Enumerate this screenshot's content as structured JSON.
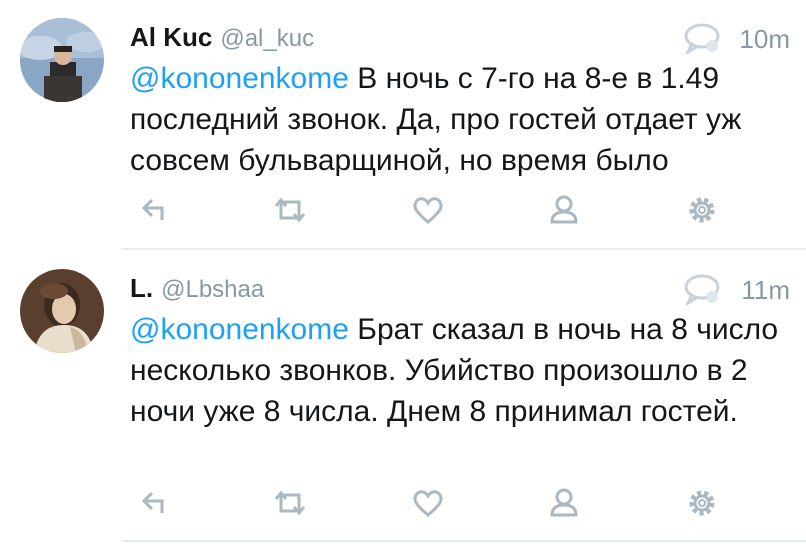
{
  "tweets": [
    {
      "name": "Al Kuc",
      "handle": "@al_kuc",
      "time": "10m",
      "mention": "@kononenkome",
      "text": " В ночь с 7-го на 8-е в 1.49 последний звонок. Да, про гостей отдает уж совсем бульварщиной, но время было"
    },
    {
      "name": "L.",
      "handle": "@Lbshaa",
      "time": "11m",
      "mention": "@kononenkome",
      "text": " Брат  сказал в ночь на 8 число несколько звонков. Убийство произошло в 2 ночи уже 8 числа. Днем 8 принимал гостей."
    }
  ],
  "colors": {
    "link": "#1da1f2",
    "secondary": "#8899a6",
    "icon": "#aab8c2",
    "divider": "#e6ecf0"
  },
  "icons": [
    "reply-icon",
    "retweet-icon",
    "heart-icon",
    "person-icon",
    "gear-icon",
    "conversation-icon"
  ]
}
